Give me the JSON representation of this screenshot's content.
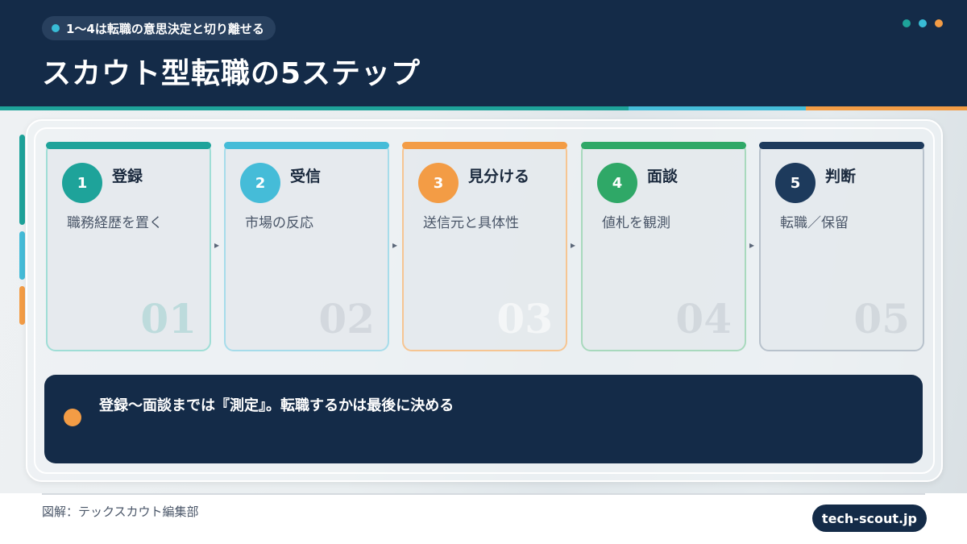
{
  "header": {
    "badge": "1〜4は転職の意思決定と切り離せる",
    "title": "スカウト型転職の5ステップ",
    "dot_colors": [
      "#1ea39a",
      "#38bcd6",
      "#f39c45"
    ]
  },
  "steps": [
    {
      "num": "1",
      "title": "登録",
      "desc": "職務経歴を置く",
      "big": "01",
      "color": "#1ea39a"
    },
    {
      "num": "2",
      "title": "受信",
      "desc": "市場の反応",
      "big": "02",
      "color": "#45bcd8"
    },
    {
      "num": "3",
      "title": "見分ける",
      "desc": "送信元と具体性",
      "big": "03",
      "color": "#f39c45"
    },
    {
      "num": "4",
      "title": "面談",
      "desc": "値札を観測",
      "big": "04",
      "color": "#2fa867"
    },
    {
      "num": "5",
      "title": "判断",
      "desc": "転職／保留",
      "big": "05",
      "color": "#1d3a5c"
    }
  ],
  "note": {
    "text": "登録〜面談までは『測定』。転職するかは最後に決める",
    "dot_color": "#f39c45"
  },
  "footer": {
    "credit": "図解：テックスカウト編集部",
    "badge": "tech-scout.jp"
  }
}
